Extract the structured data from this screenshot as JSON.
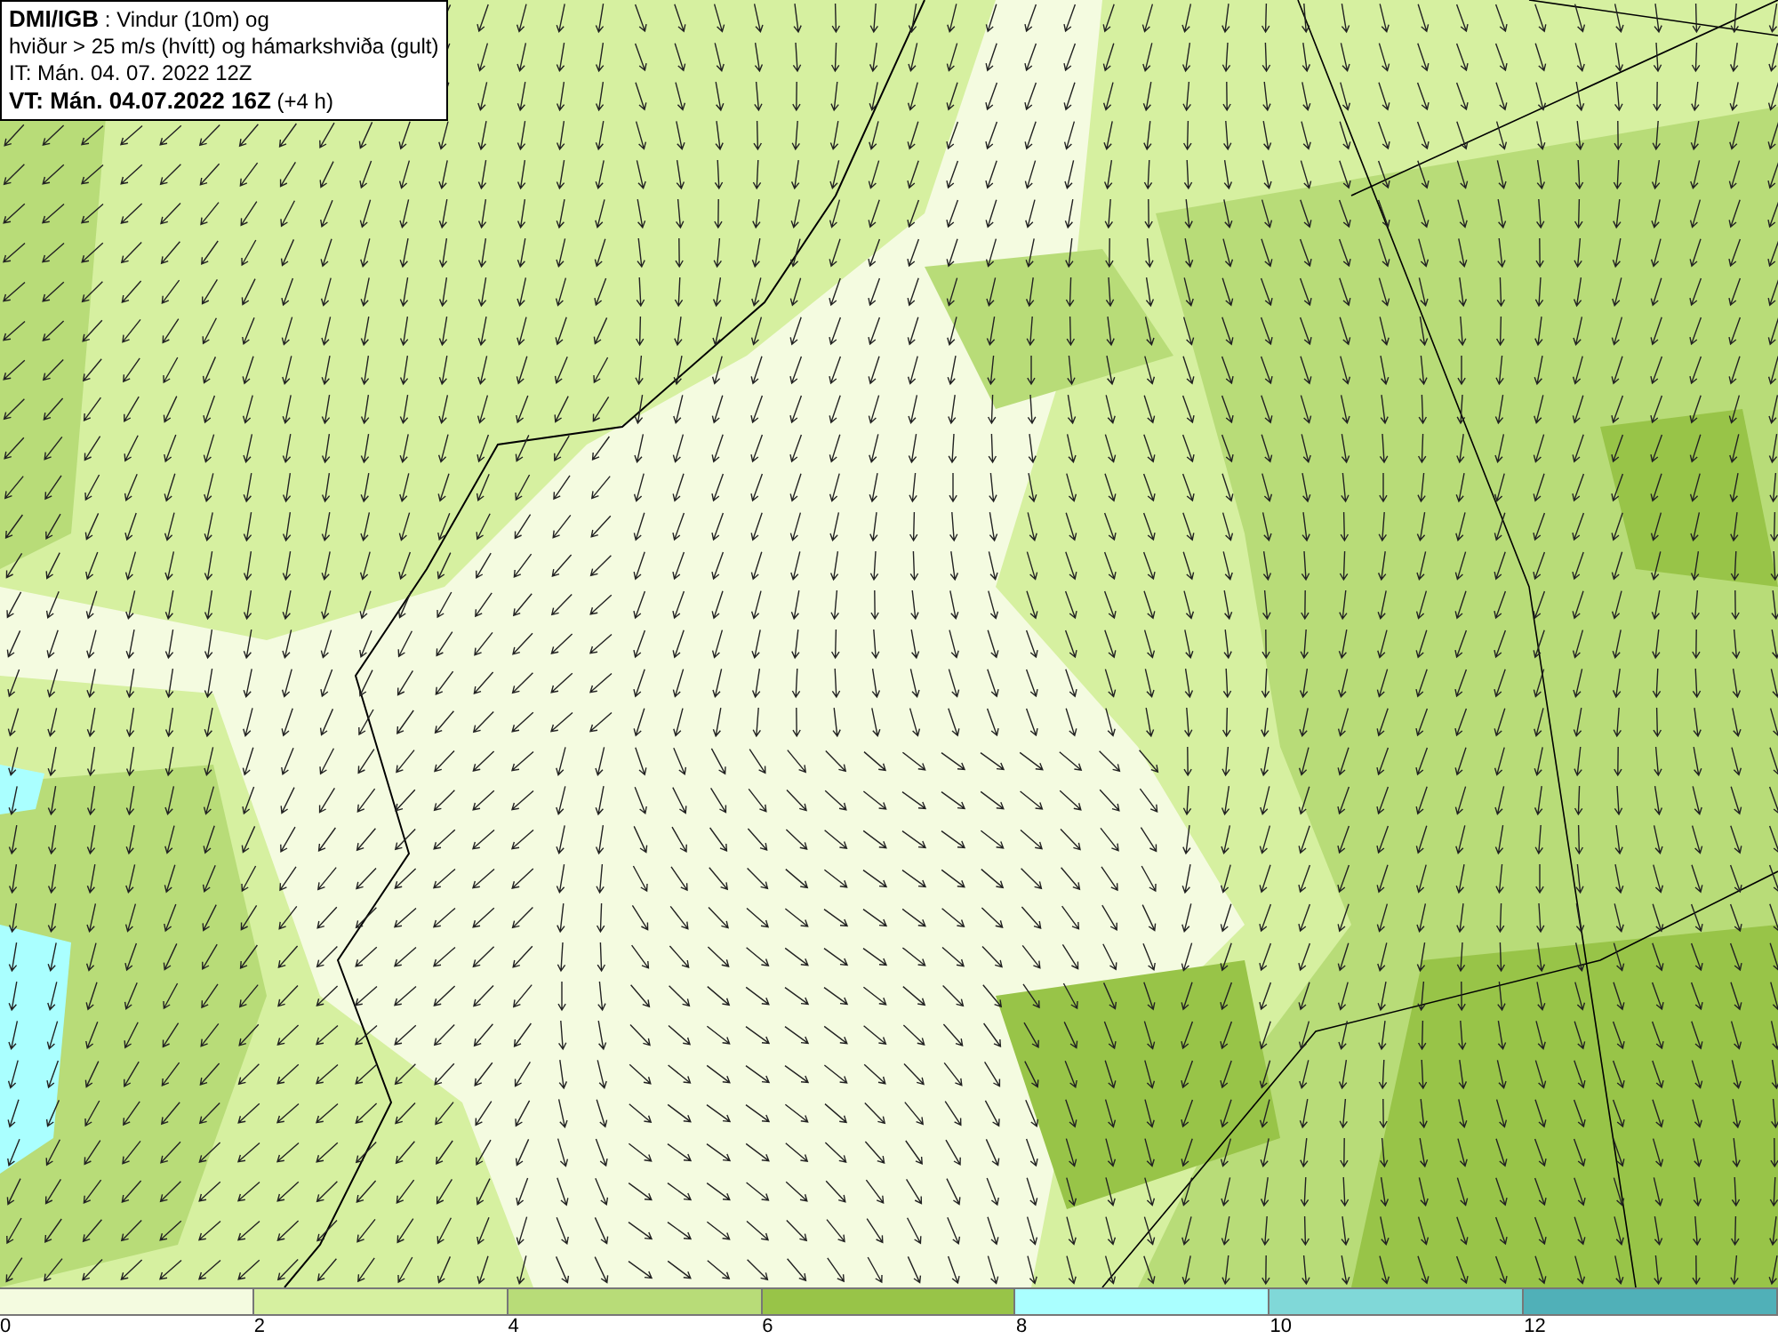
{
  "title_box": {
    "lines": [
      "**DMI/IGB** : Vindur (10m) og",
      "hviður > 25 m/s (hvítt) og hámarkshviða (gult)",
      "IT: Mán. 04. 07. 2022 12Z",
      "**VT: Mán. 04.07.2022 16Z** (+4 h)"
    ]
  },
  "legend": {
    "bins": [
      {
        "label": "0",
        "color": "#f4fbe0"
      },
      {
        "label": "2",
        "color": "#d6f0a0"
      },
      {
        "label": "4",
        "color": "#b8dc78"
      },
      {
        "label": "6",
        "color": "#98c448"
      },
      {
        "label": "8",
        "color": "#aaffff"
      },
      {
        "label": "10",
        "color": "#80d8d8"
      },
      {
        "label": "12",
        "color": "#50b0b8"
      }
    ]
  }
}
